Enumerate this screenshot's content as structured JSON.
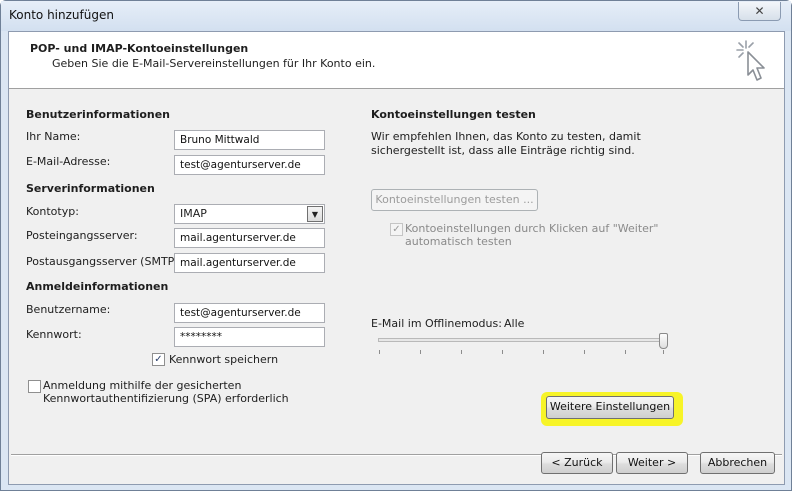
{
  "window": {
    "title": "Konto hinzufügen",
    "close_glyph": "✕"
  },
  "header": {
    "title": "POP- und IMAP-Kontoeinstellungen",
    "subtitle": "Geben Sie die E-Mail-Servereinstellungen für Ihr Konto ein.",
    "icon": "wizard-cursor-icon"
  },
  "user_info": {
    "heading": "Benutzerinformationen",
    "name_label": "Ihr Name:",
    "name_value": "Bruno Mittwald",
    "email_label": "E-Mail-Adresse:",
    "email_value": "test@agenturserver.de"
  },
  "server_info": {
    "heading": "Serverinformationen",
    "type_label": "Kontotyp:",
    "type_value": "IMAP",
    "incoming_label": "Posteingangsserver:",
    "incoming_value": "mail.agenturserver.de",
    "outgoing_label": "Postausgangsserver (SMTP):",
    "outgoing_value": "mail.agenturserver.de"
  },
  "login_info": {
    "heading": "Anmeldeinformationen",
    "username_label": "Benutzername:",
    "username_value": "test@agenturserver.de",
    "password_label": "Kennwort:",
    "password_value": "********",
    "remember_label": "Kennwort speichern",
    "remember_checked": true,
    "spa_label_line1": "Anmeldung mithilfe der gesicherten",
    "spa_label_line2": "Kennwortauthentifizierung (SPA) erforderlich",
    "spa_checked": false
  },
  "test_settings": {
    "heading": "Kontoeinstellungen testen",
    "desc_line1": "Wir empfehlen Ihnen, das Konto zu testen, damit",
    "desc_line2": "sichergestellt ist, dass alle Einträge richtig sind.",
    "test_button": "Kontoeinstellungen testen ...",
    "auto_test_line1": "Kontoeinstellungen durch Klicken auf \"Weiter\"",
    "auto_test_line2": "automatisch testen",
    "auto_test_checked": true
  },
  "offline": {
    "label": "E-Mail im Offlinemodus:",
    "value": "Alle",
    "level_fraction": 1.0
  },
  "more_settings_button": "Weitere Einstellungen",
  "footer": {
    "back": "< Zurück",
    "next": "Weiter >",
    "cancel": "Abbrechen"
  },
  "colors": {
    "highlight": "#f7f428",
    "window_frame": "#dbe6f3"
  }
}
